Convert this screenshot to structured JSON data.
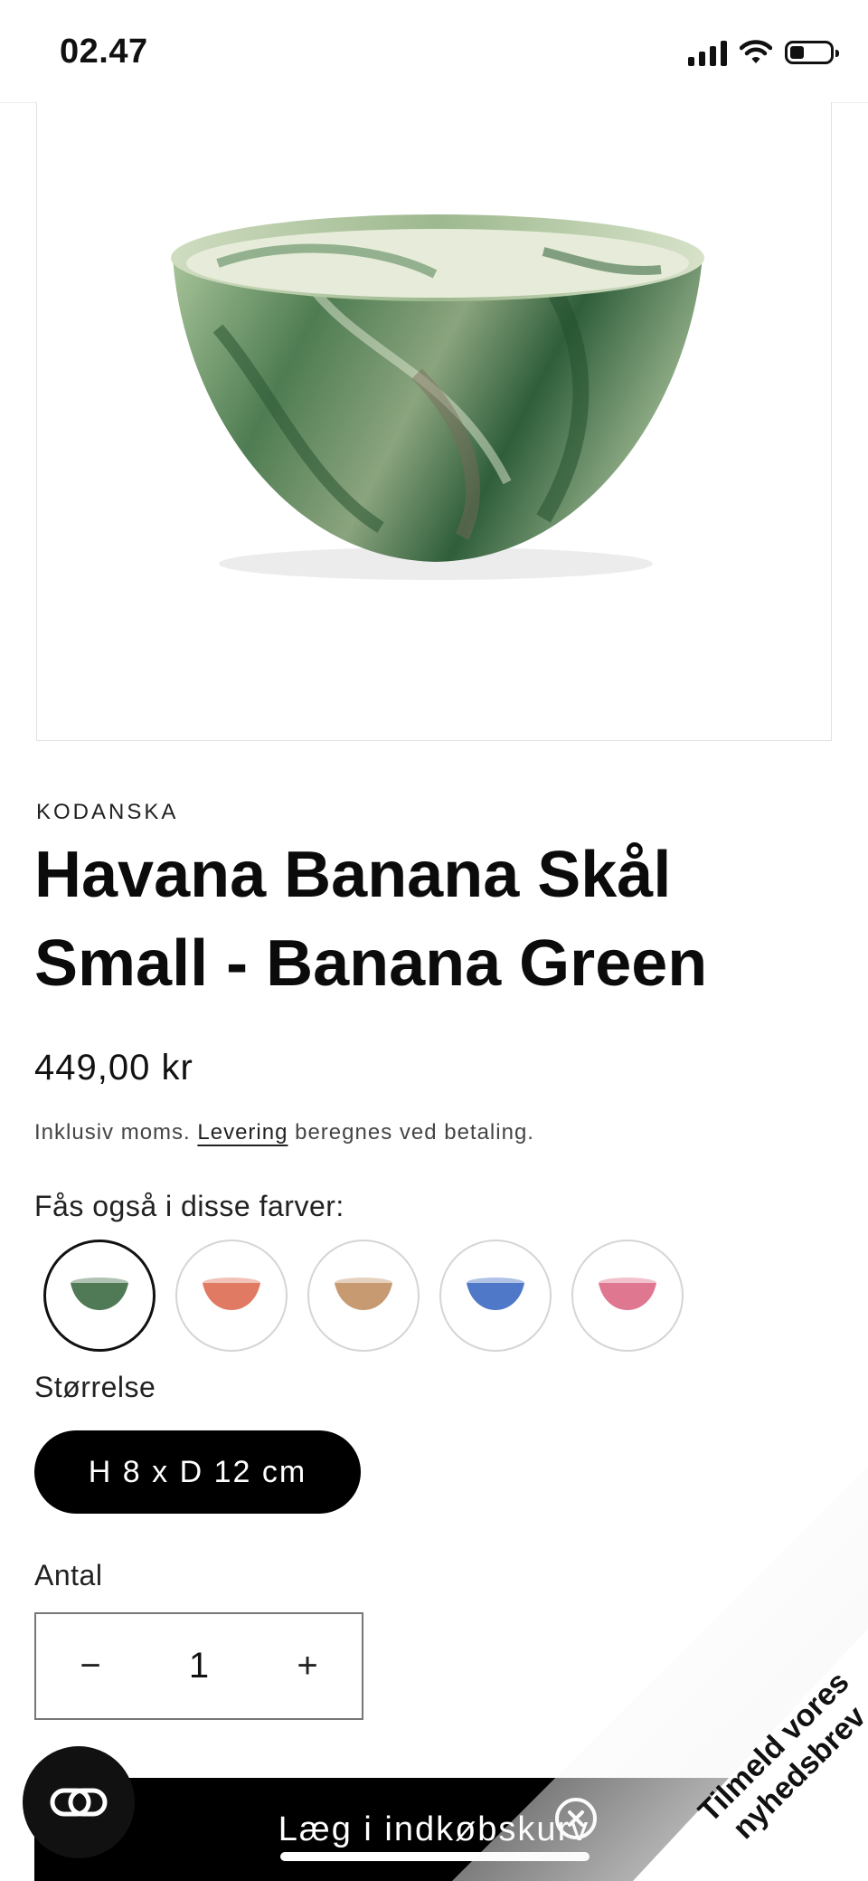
{
  "status_bar": {
    "time": "02.47",
    "battery_level": 0.35
  },
  "product": {
    "vendor": "KODANSKA",
    "title": "Havana Banana Skål Small - Banana Green",
    "price": "449,00 kr",
    "tax_note_prefix": "Inklusiv moms.",
    "tax_note_link": "Levering",
    "tax_note_suffix": "beregnes ved betaling."
  },
  "colors": {
    "label": "Fås også i disse farver:",
    "options": [
      {
        "name": "green",
        "color": "#4f7a55",
        "selected": true
      },
      {
        "name": "coral",
        "color": "#e07a62",
        "selected": false
      },
      {
        "name": "sand",
        "color": "#c89a72",
        "selected": false
      },
      {
        "name": "blue",
        "color": "#4f78c8",
        "selected": false
      },
      {
        "name": "pink",
        "color": "#e07790",
        "selected": false
      }
    ]
  },
  "size": {
    "label": "Størrelse",
    "value": "H 8 x D 12 cm"
  },
  "quantity": {
    "label": "Antal",
    "value": "1",
    "decrease": "−",
    "increase": "+"
  },
  "cart_button_label": "Læg i indkøbskurv",
  "newsletter": {
    "line1": "Tilmeld vores",
    "line2": "nyhedsbrev"
  }
}
